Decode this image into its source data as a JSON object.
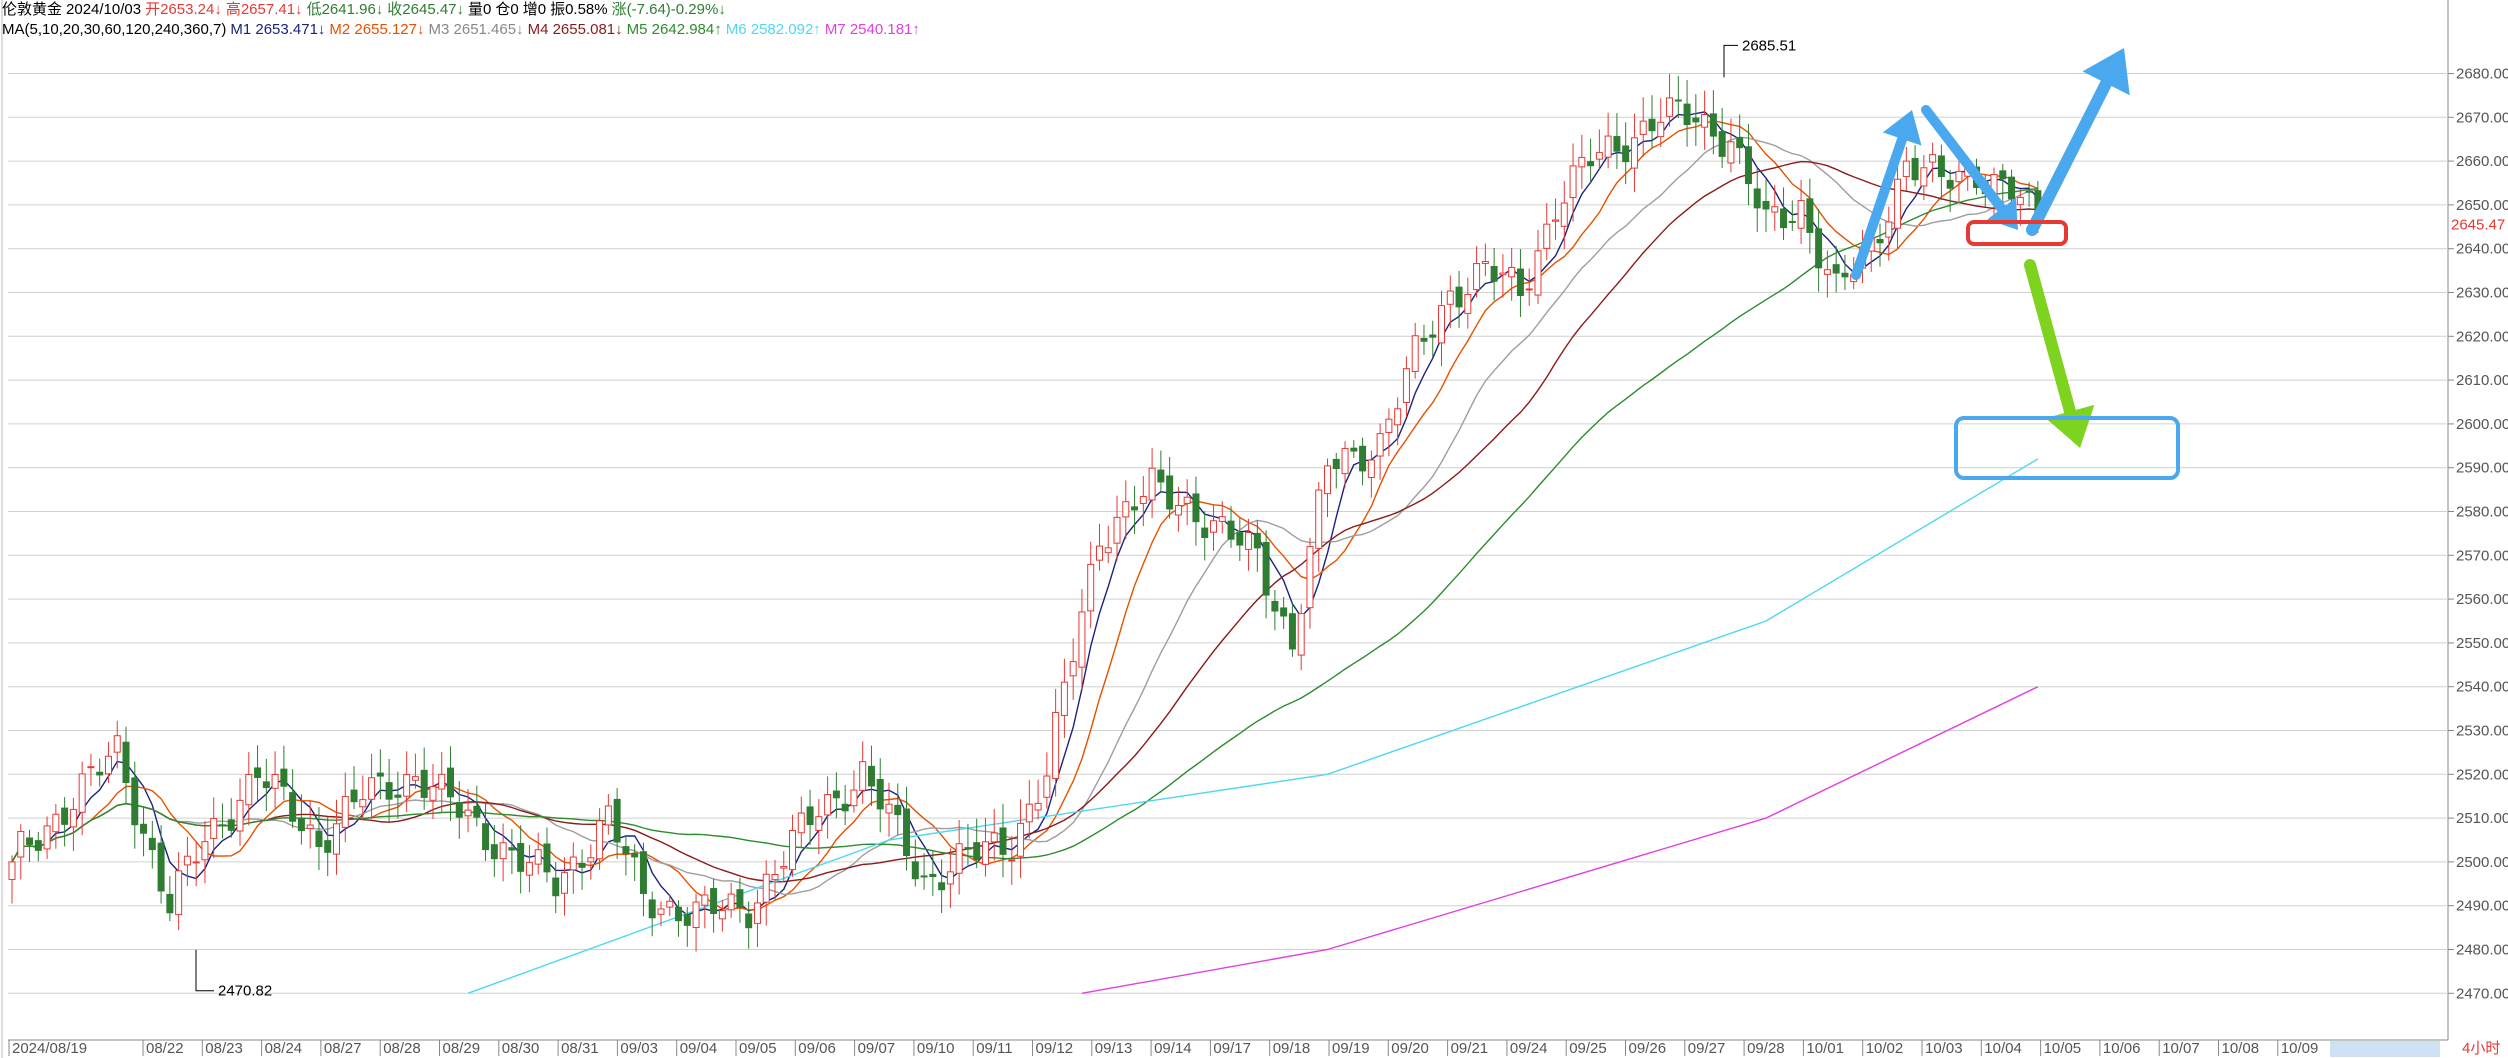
{
  "header": {
    "line1": {
      "name": "伦敦黄金",
      "date": "2024/10/03",
      "open": "开2653.24↓",
      "high": "高2657.41↓",
      "low": "低2641.96↓",
      "close": "收2645.47↓",
      "volume": "量0",
      "position": "仓0",
      "increase": "增0",
      "amplitude": "振0.58%",
      "change": "涨(-7.64)-0.29%↓"
    },
    "line2": {
      "ma_label": "MA(5,10,20,30,60,120,240,360,7)",
      "m1": "M1 2653.471↓",
      "m2": "M2 2655.127↓",
      "m3": "M3 2651.465↓",
      "m4": "M4 2655.081↓",
      "m5": "M5 2642.984↑",
      "m6": "M6 2582.092↑",
      "m7": "M7 2540.181↑"
    }
  },
  "colors": {
    "up": "#e53935",
    "down": "#2e7d32",
    "m1": "#1a237e",
    "m2": "#e65100",
    "m3": "#9e9e9e",
    "m4": "#8b1a1a",
    "m5": "#2e8b2e",
    "m6": "#4dd8f0",
    "m7": "#e040e0",
    "grid": "#d0d0d0",
    "arrow_blue": "#4aa8ee",
    "arrow_green": "#7ed321",
    "box_red": "#e53935",
    "box_blue": "#4aa8ee"
  },
  "chart_data": {
    "type": "candlestick",
    "y_axis": {
      "ticks": [
        "2680.00",
        "2670.00",
        "2660.00",
        "2650.00",
        "2640.00",
        "2630.00",
        "2620.00",
        "2610.00",
        "2600.00",
        "2590.00",
        "2580.00",
        "2570.00",
        "2560.00",
        "2550.00",
        "2540.00",
        "2530.00",
        "2520.00",
        "2510.00",
        "2500.00",
        "2490.00",
        "2480.00",
        "2470.00"
      ],
      "tick_values": [
        2680,
        2670,
        2660,
        2650,
        2640,
        2630,
        2620,
        2610,
        2600,
        2590,
        2580,
        2570,
        2560,
        2550,
        2540,
        2530,
        2520,
        2510,
        2500,
        2490,
        2480,
        2470
      ],
      "range": [
        2468,
        2694
      ],
      "current_price_label": "2645.47",
      "current_price": 2645.47
    },
    "x_axis": {
      "labels": [
        "2024/08/19",
        "08/22",
        "08/23",
        "08/24",
        "08/27",
        "08/28",
        "08/29",
        "08/30",
        "08/31",
        "09/03",
        "09/04",
        "09/05",
        "09/06",
        "09/07",
        "09/10",
        "09/11",
        "09/12",
        "09/13",
        "09/14",
        "09/17",
        "09/18",
        "09/19",
        "09/20",
        "09/21",
        "09/24",
        "09/25",
        "09/26",
        "09/27",
        "09/28",
        "10/01",
        "10/02",
        "10/03",
        "10/04",
        "10/05",
        "10/06",
        "10/07",
        "10/08",
        "10/09"
      ],
      "unit_label": "4小时"
    },
    "annotations": {
      "high_label": "2685.51",
      "high_value": 2685.51,
      "low_label": "2470.82",
      "low_value": 2470.82
    },
    "key_closes": [
      [
        0,
        2500
      ],
      [
        12,
        2525
      ],
      [
        18,
        2490
      ],
      [
        22,
        2505
      ],
      [
        28,
        2520
      ],
      [
        35,
        2505
      ],
      [
        40,
        2515
      ],
      [
        46,
        2520
      ],
      [
        52,
        2510
      ],
      [
        58,
        2500
      ],
      [
        62,
        2495
      ],
      [
        68,
        2510
      ],
      [
        72,
        2492
      ],
      [
        78,
        2488
      ],
      [
        84,
        2490
      ],
      [
        92,
        2512
      ],
      [
        97,
        2520
      ],
      [
        100,
        2510
      ],
      [
        104,
        2496
      ],
      [
        108,
        2500
      ],
      [
        114,
        2505
      ],
      [
        118,
        2520
      ],
      [
        124,
        2575
      ],
      [
        130,
        2585
      ],
      [
        134,
        2582
      ],
      [
        138,
        2575
      ],
      [
        142,
        2570
      ],
      [
        146,
        2550
      ],
      [
        150,
        2590
      ],
      [
        156,
        2596
      ],
      [
        160,
        2615
      ],
      [
        164,
        2630
      ],
      [
        168,
        2635
      ],
      [
        172,
        2630
      ],
      [
        176,
        2650
      ],
      [
        180,
        2660
      ],
      [
        184,
        2665
      ],
      [
        188,
        2670
      ],
      [
        192,
        2670
      ],
      [
        196,
        2665
      ],
      [
        200,
        2645
      ],
      [
        204,
        2650
      ],
      [
        208,
        2630
      ],
      [
        212,
        2640
      ],
      [
        216,
        2660
      ],
      [
        220,
        2655
      ],
      [
        224,
        2658
      ],
      [
        228,
        2653
      ],
      [
        231,
        2645.47
      ]
    ],
    "moving_averages": [
      {
        "name": "M1",
        "period": 5
      },
      {
        "name": "M2",
        "period": 10
      },
      {
        "name": "M3",
        "period": 20
      },
      {
        "name": "M4",
        "period": 30
      },
      {
        "name": "M5",
        "period": 60
      },
      {
        "name": "M6",
        "points": [
          [
            52,
            2470
          ],
          [
            100,
            2505
          ],
          [
            150,
            2520
          ],
          [
            200,
            2555
          ],
          [
            231,
            2592
          ]
        ]
      },
      {
        "name": "M7",
        "points": [
          [
            122,
            2470
          ],
          [
            150,
            2480
          ],
          [
            200,
            2510
          ],
          [
            231,
            2540
          ]
        ]
      }
    ]
  }
}
